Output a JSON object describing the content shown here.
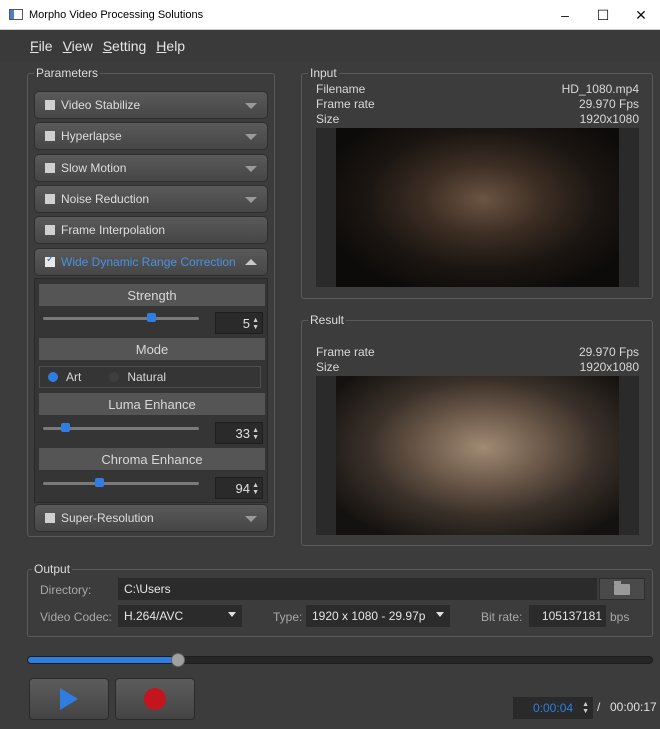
{
  "window": {
    "title": "Morpho Video Processing Solutions",
    "minimize": "–",
    "maximize": "☐",
    "close": "✕"
  },
  "menu": [
    {
      "label": "File",
      "key": "F",
      "rest": "ile"
    },
    {
      "label": "View",
      "key": "V",
      "rest": "iew"
    },
    {
      "label": "Setting",
      "key": "S",
      "rest": "etting"
    },
    {
      "label": "Help",
      "key": "H",
      "rest": "elp"
    }
  ],
  "parameters": {
    "label": "Parameters",
    "items": [
      {
        "label": "Video Stabilize",
        "checked": false
      },
      {
        "label": "Hyperlapse",
        "checked": false
      },
      {
        "label": "Slow Motion",
        "checked": false
      },
      {
        "label": "Noise Reduction",
        "checked": false
      },
      {
        "label": "Frame Interpolation",
        "checked": false
      },
      {
        "label": "Wide Dynamic Range Correction",
        "checked": true,
        "expanded": true
      },
      {
        "label": "Super-Resolution",
        "checked": false
      }
    ],
    "wdr": {
      "strength": {
        "label": "Strength",
        "value": "5"
      },
      "mode": {
        "label": "Mode",
        "options": [
          "Art",
          "Natural"
        ],
        "selected": "Art"
      },
      "luma": {
        "label": "Luma Enhance",
        "value": "33"
      },
      "chroma": {
        "label": "Chroma Enhance",
        "value": "94"
      }
    }
  },
  "input": {
    "label": "Input",
    "filename_label": "Filename",
    "filename": "HD_1080.mp4",
    "framerate_label": "Frame rate",
    "framerate": "29.970 Fps",
    "size_label": "Size",
    "size": "1920x1080"
  },
  "result": {
    "label": "Result",
    "framerate_label": "Frame rate",
    "framerate": "29.970 Fps",
    "size_label": "Size",
    "size": "1920x1080"
  },
  "output": {
    "label": "Output",
    "directory_label": "Directory:",
    "directory": "C:\\Users",
    "codec_label": "Video Codec:",
    "codec": "H.264/AVC",
    "type_label": "Type:",
    "type": "1920 x 1080 - 29.97p",
    "bitrate_label": "Bit rate:",
    "bitrate": "105137181",
    "bitrate_unit": "bps"
  },
  "playback": {
    "progress": 0.24,
    "current_time": "0:00:04",
    "separator": "/",
    "total_time": "00:00:17"
  },
  "colors": {
    "accent": "#2f7de0",
    "record": "#c4141e"
  }
}
